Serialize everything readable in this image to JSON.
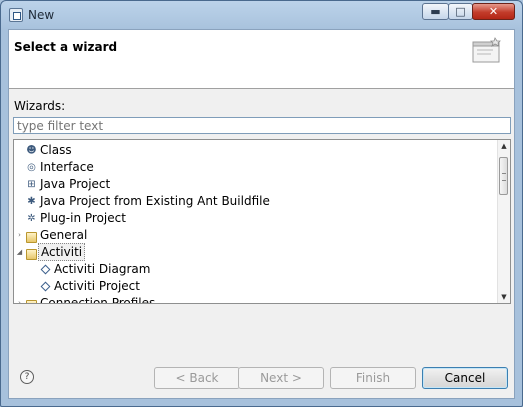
{
  "window": {
    "title": "New",
    "controls": {
      "minimize": "▬",
      "maximize": "□",
      "close": "✕"
    }
  },
  "header": {
    "title": "Select a wizard",
    "graphic_icon": "wizard-banner-icon"
  },
  "wizards_label": "Wizards:",
  "filter": {
    "placeholder": "type filter text",
    "value": ""
  },
  "tree": {
    "items": [
      {
        "label": "Class",
        "icon": "class-icon",
        "glyph": "☻"
      },
      {
        "label": "Interface",
        "icon": "interface-icon",
        "glyph": "◎"
      },
      {
        "label": "Java Project",
        "icon": "java-project-icon",
        "glyph": "⊞"
      },
      {
        "label": "Java Project from Existing Ant Buildfile",
        "icon": "ant-project-icon",
        "glyph": "✱"
      },
      {
        "label": "Plug-in Project",
        "icon": "plugin-project-icon",
        "glyph": "✲"
      },
      {
        "label": "General",
        "icon": "folder-icon",
        "expander": "›"
      },
      {
        "label": "Activiti",
        "icon": "folder-open-icon",
        "expander": "◢"
      },
      {
        "label": "Activiti Diagram",
        "icon": "activiti-diagram-icon"
      },
      {
        "label": "Activiti Project",
        "icon": "activiti-project-icon"
      },
      {
        "label": "Connection Profiles",
        "icon": "folder-icon",
        "expander": "›"
      }
    ],
    "scrollbar": {
      "up": "▲",
      "down": "▼",
      "position": 0.0
    }
  },
  "buttons": {
    "help": "?",
    "back": "< Back",
    "next": "Next >",
    "finish": "Finish",
    "cancel": "Cancel"
  }
}
